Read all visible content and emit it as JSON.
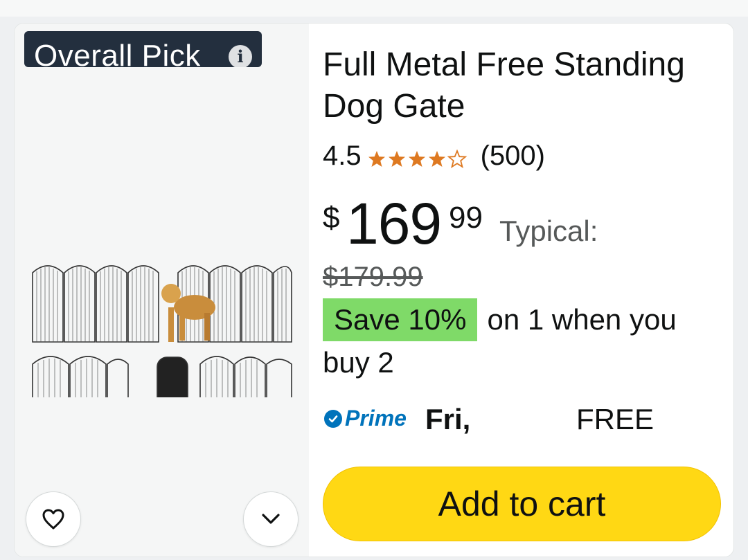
{
  "badge": {
    "label": "Overall Pick",
    "info_icon": "i"
  },
  "product": {
    "title": "Full Metal Free Standing Dog Gate",
    "rating": "4.5",
    "rating_value": 4.5,
    "review_count": "(500)",
    "price": {
      "symbol": "$",
      "whole": "169",
      "fraction": "99"
    },
    "typical_label": "Typical:",
    "list_price": "$179.99",
    "promo": {
      "badge": "Save 10%",
      "text": "on 1 when you buy 2"
    },
    "delivery": {
      "prime_label": "Prime",
      "day": "Fri,",
      "shipping": "FREE"
    },
    "add_to_cart": "Add to cart"
  },
  "icons": {
    "wishlist": "heart-icon",
    "expand": "chevron-down-icon",
    "info": "info-icon",
    "prime": "prime-check-icon",
    "star": "star-icon"
  },
  "colors": {
    "badge_bg": "#232f3e",
    "star": "#de7921",
    "save_badge": "#7fda68",
    "prime": "#0073bb",
    "cart_button": "#ffd814"
  }
}
